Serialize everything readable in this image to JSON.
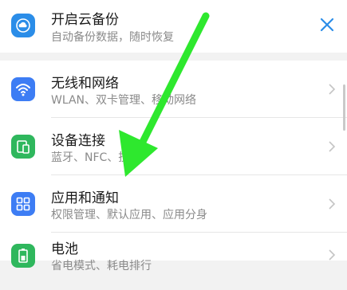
{
  "banner": {
    "title": "开启云备份",
    "subtitle": "自动备份数据，随时恢复",
    "icon": "cloud-backup-icon",
    "close_icon": "close-icon"
  },
  "settings": {
    "items": [
      {
        "title": "无线和网络",
        "subtitle": "WLAN、双卡管理、移动网络",
        "icon": "wifi-icon",
        "color": "#3d7df4"
      },
      {
        "title": "设备连接",
        "subtitle": "蓝牙、NFC、投屏",
        "icon": "device-connection-icon",
        "color": "#2fb75d"
      },
      {
        "title": "应用和通知",
        "subtitle": "权限管理、默认应用、应用分身",
        "icon": "apps-grid-icon",
        "color": "#3d7df4"
      },
      {
        "title": "电池",
        "subtitle": "省电模式、耗电排行",
        "icon": "battery-icon",
        "color": "#2fb75d"
      }
    ]
  },
  "colors": {
    "accent": "#2b8de8",
    "annotation_arrow": "#2ee82e",
    "background": "#f2f2f2"
  }
}
